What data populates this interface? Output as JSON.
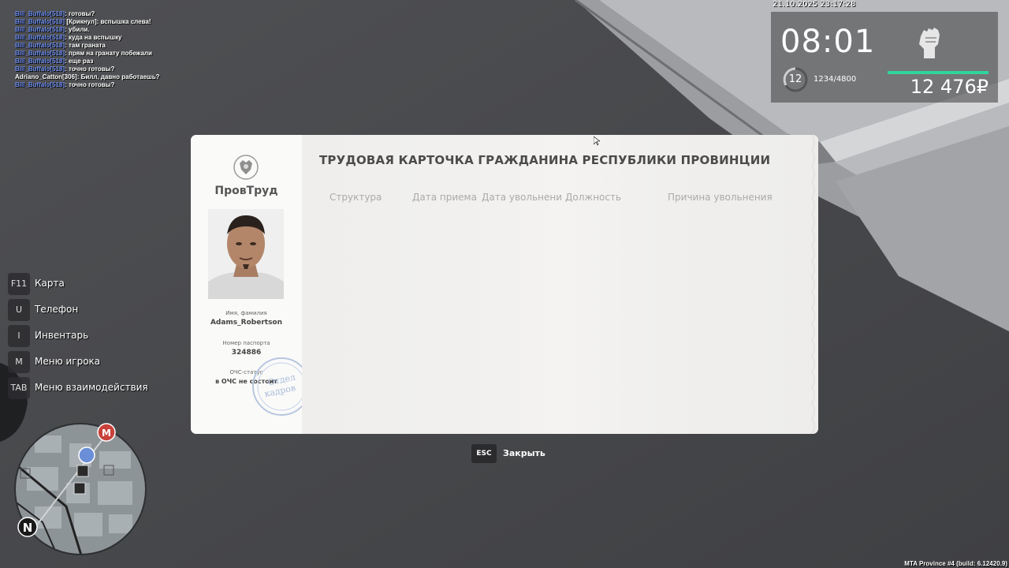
{
  "chat": [
    {
      "nick": "Bill_Buffalo[518]",
      "msg": ": готовы?",
      "nick_color": "blue"
    },
    {
      "nick": "Bill_Buffalo[518]",
      "msg": " [Крикнул]: вспышка слева!",
      "nick_color": "blue"
    },
    {
      "nick": "Bill_Buffalo[518]",
      "msg": ": убили.",
      "nick_color": "blue"
    },
    {
      "nick": "Bill_Buffalo[518]",
      "msg": ": куда на вспышку",
      "nick_color": "blue"
    },
    {
      "nick": "Bill_Buffalo[518]",
      "msg": ": там граната",
      "nick_color": "blue"
    },
    {
      "nick": "Bill_Buffalo[518]",
      "msg": ": прям на гранату побежали",
      "nick_color": "blue"
    },
    {
      "nick": "Bill_Buffalo[518]",
      "msg": ": еще раз",
      "nick_color": "blue"
    },
    {
      "nick": "Bill_Buffalo[518]",
      "msg": ": точно готовы?",
      "nick_color": "blue"
    },
    {
      "nick": "Adriano_Catton[306]",
      "msg": ": Билл, давно работаешь?",
      "nick_color": "white"
    },
    {
      "nick": "Bill_Buffalo[518]",
      "msg": ": точно готовы?",
      "nick_color": "blue"
    }
  ],
  "hud": {
    "datetime": "21.10.2025 23:17:28",
    "time": "08:01",
    "level": "12",
    "xp": "1234/4800",
    "money": "12 476₽",
    "fist_icon": "fist-icon",
    "health_color": "#2fd59a"
  },
  "keys": [
    {
      "key": "F11",
      "label": "Карта"
    },
    {
      "key": "U",
      "label": "Телефон"
    },
    {
      "key": "I",
      "label": "Инвентарь"
    },
    {
      "key": "M",
      "label": "Меню игрока"
    },
    {
      "key": "TAB",
      "label": "Меню взаимодействия"
    }
  ],
  "minimap": {
    "north_label": "N",
    "metro_label": "М"
  },
  "card": {
    "brand": "ПровТруд",
    "title": "ТРУДОВАЯ КАРТОЧКА ГРАЖДАНИНА РЕСПУБЛИКИ ПРОВИНЦИИ",
    "name_label": "Имя, фамилия",
    "name_value": "Adams_Robertson",
    "passport_label": "Номер паспорта",
    "passport_value": "324886",
    "status_label": "ОЧС-статус",
    "status_value": "в ОЧС не состоит",
    "stamp_text_1": "Отдел",
    "stamp_text_2": "кадров",
    "columns": [
      "Структура",
      "Дата приема",
      "Дата увольнени",
      "Должность",
      "Причина увольнения"
    ]
  },
  "footer": {
    "esc_key": "ESC",
    "esc_label": "Закрыть",
    "build": "MTA Province #4 (build: 6.12420.9)"
  }
}
